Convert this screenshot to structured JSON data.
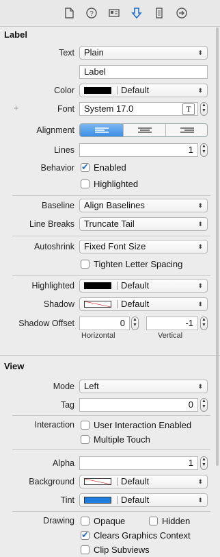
{
  "toolbar": {
    "icons": [
      "file-icon",
      "help-icon",
      "identity-icon",
      "attributes-icon",
      "size-icon",
      "connections-icon"
    ]
  },
  "label_section": {
    "title": "Label",
    "text_label": "Text",
    "text_value": "Plain",
    "label_value": "Label",
    "color_label": "Color",
    "color_value": "Default",
    "font_label": "Font",
    "font_value": "System 17.0",
    "font_btn": "T",
    "alignment_label": "Alignment",
    "lines_label": "Lines",
    "lines_value": "1",
    "behavior_label": "Behavior",
    "enabled_label": "Enabled",
    "highlighted_label": "Highlighted",
    "baseline_label": "Baseline",
    "baseline_value": "Align Baselines",
    "linebreaks_label": "Line Breaks",
    "linebreaks_value": "Truncate Tail",
    "autoshrink_label": "Autoshrink",
    "autoshrink_value": "Fixed Font Size",
    "tighten_label": "Tighten Letter Spacing",
    "highlighted2_label": "Highlighted",
    "highlighted2_value": "Default",
    "shadow_label": "Shadow",
    "shadow_value": "Default",
    "shadow_offset_label": "Shadow Offset",
    "horizontal_value": "0",
    "vertical_value": "-1",
    "horizontal_label": "Horizontal",
    "vertical_label": "Vertical",
    "plus": "+"
  },
  "view_section": {
    "title": "View",
    "mode_label": "Mode",
    "mode_value": "Left",
    "tag_label": "Tag",
    "tag_value": "0",
    "interaction_label": "Interaction",
    "user_interaction_label": "User Interaction Enabled",
    "multiple_touch_label": "Multiple Touch",
    "alpha_label": "Alpha",
    "alpha_value": "1",
    "background_label": "Background",
    "background_value": "Default",
    "tint_label": "Tint",
    "tint_value": "Default",
    "drawing_label": "Drawing",
    "opaque_label": "Opaque",
    "hidden_label": "Hidden",
    "clears_label": "Clears Graphics Context",
    "clip_label": "Clip Subviews"
  },
  "colors": {
    "accent": "#1b6fd0",
    "tint": "#1f7fe0",
    "shadow_swatch": "#cc2222"
  }
}
